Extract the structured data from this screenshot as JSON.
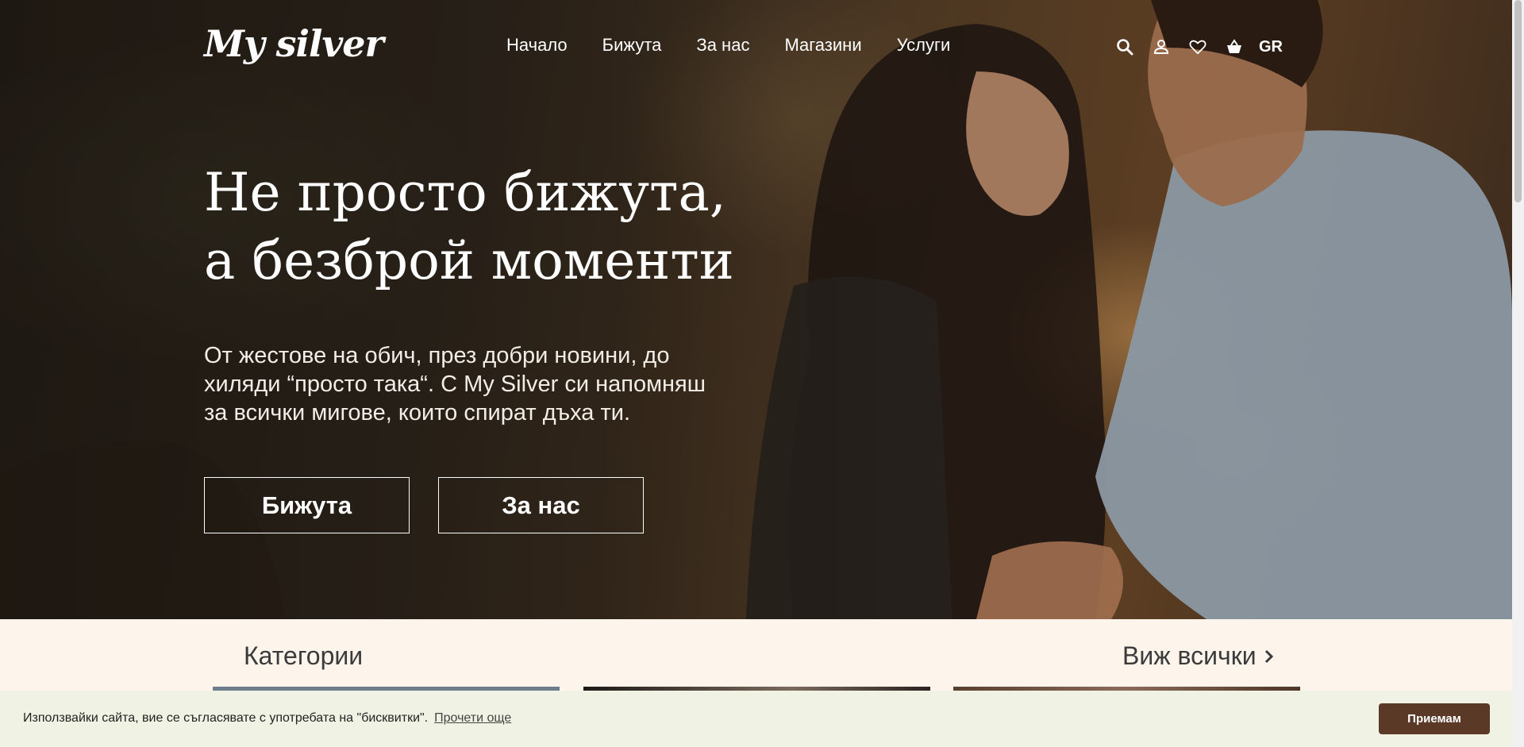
{
  "header": {
    "logo": "My silver",
    "nav": [
      "Начало",
      "Бижута",
      "За нас",
      "Магазини",
      "Услуги"
    ],
    "icons": [
      "search-icon",
      "user-icon",
      "heart-icon",
      "basket-icon"
    ],
    "language": "GR"
  },
  "hero": {
    "title_line1": "Не просто бижута,",
    "title_line2": "а безброй моменти",
    "subtitle": "От жестове на обич, през добри новини, до хиляди “просто така“. С My Silver си напомняш за всички мигове, които спират дъха ти.",
    "buttons": {
      "jewelry": "Бижута",
      "about": "За нас"
    }
  },
  "categories": {
    "title": "Категории",
    "view_all": "Виж всички"
  },
  "cookie": {
    "text": "Използвайки сайта, вие се съгласявате с употребата на \"бисквитки\".",
    "link": "Прочети още",
    "accept": "Приемам"
  },
  "colors": {
    "cookie_button": "#5a3926",
    "cookie_bar": "#f0f2e4",
    "categories_bg": "#fdf5ec"
  }
}
